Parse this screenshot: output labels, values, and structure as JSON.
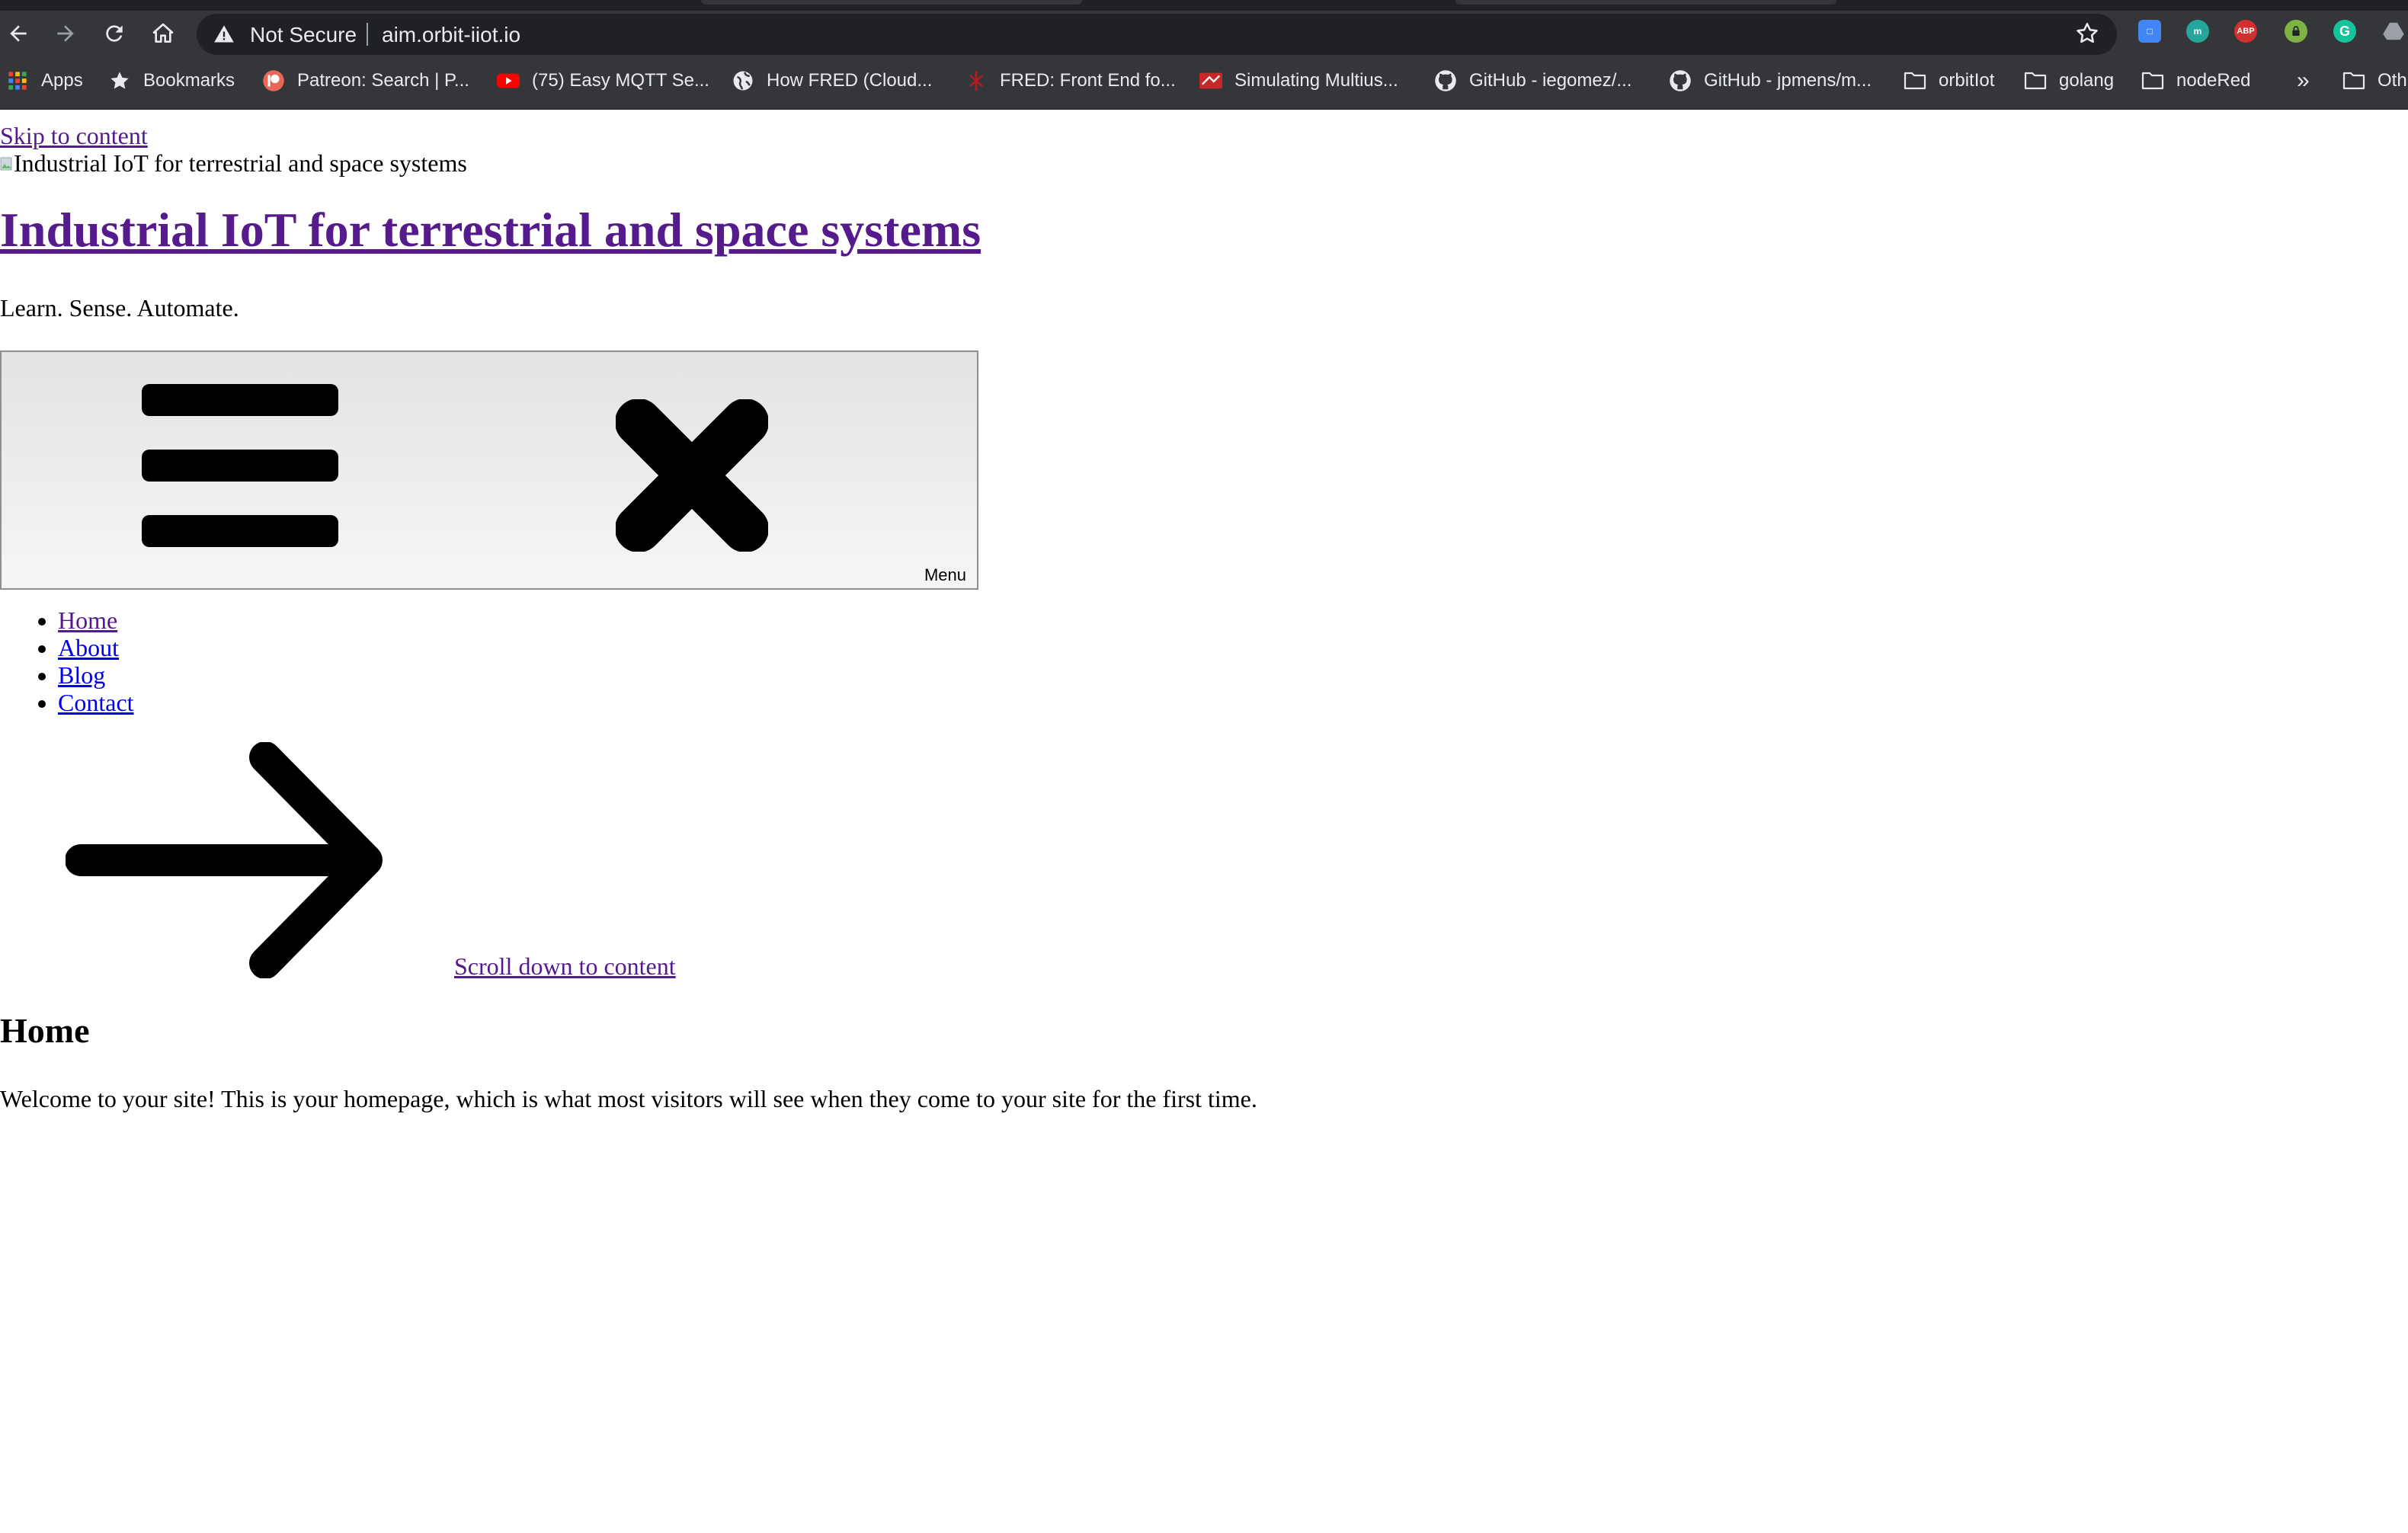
{
  "browser": {
    "security_status": "Not Secure",
    "url": "aim.orbit-iiot.io",
    "bookmarks": [
      {
        "label": "Apps",
        "icon": "apps-grid-icon"
      },
      {
        "label": "Bookmarks",
        "icon": "star-icon"
      },
      {
        "label": "Patreon: Search | P...",
        "icon": "patreon-icon"
      },
      {
        "label": "(75) Easy MQTT Se...",
        "icon": "youtube-icon"
      },
      {
        "label": "How FRED (Cloud...",
        "icon": "globe-icon"
      },
      {
        "label": "FRED: Front End fo...",
        "icon": "fred-icon"
      },
      {
        "label": "Simulating Multius...",
        "icon": "simulating-icon"
      },
      {
        "label": "GitHub - iegomez/...",
        "icon": "github-icon"
      },
      {
        "label": "GitHub - jpmens/m...",
        "icon": "github-icon"
      },
      {
        "label": "orbitIot",
        "icon": "folder-icon"
      },
      {
        "label": "golang",
        "icon": "folder-icon"
      },
      {
        "label": "nodeRed",
        "icon": "folder-icon"
      },
      {
        "label": "Oth",
        "icon": "folder-icon"
      }
    ],
    "overflow_label": "»",
    "extensions": [
      "translate-extension",
      "mate-extension",
      "adblock-extension",
      "lock-extension",
      "grammarly-extension",
      "drive-extension"
    ],
    "ext_labels": {
      "adblock": "ABP",
      "grammarly": "G",
      "mate": "m"
    }
  },
  "page": {
    "skip_link": "Skip to content",
    "header_image_alt": "Industrial IoT for terrestrial and space systems",
    "site_title": "Industrial IoT for terrestrial and space systems",
    "tagline": "Learn. Sense. Automate.",
    "menu_button_label": "Menu",
    "nav": [
      "Home",
      "About",
      "Blog",
      "Contact"
    ],
    "scroll_link": "Scroll down to content",
    "heading": "Home",
    "welcome_text": "Welcome to your site! This is your homepage, which is what most visitors will see when they come to your site for the first time."
  }
}
